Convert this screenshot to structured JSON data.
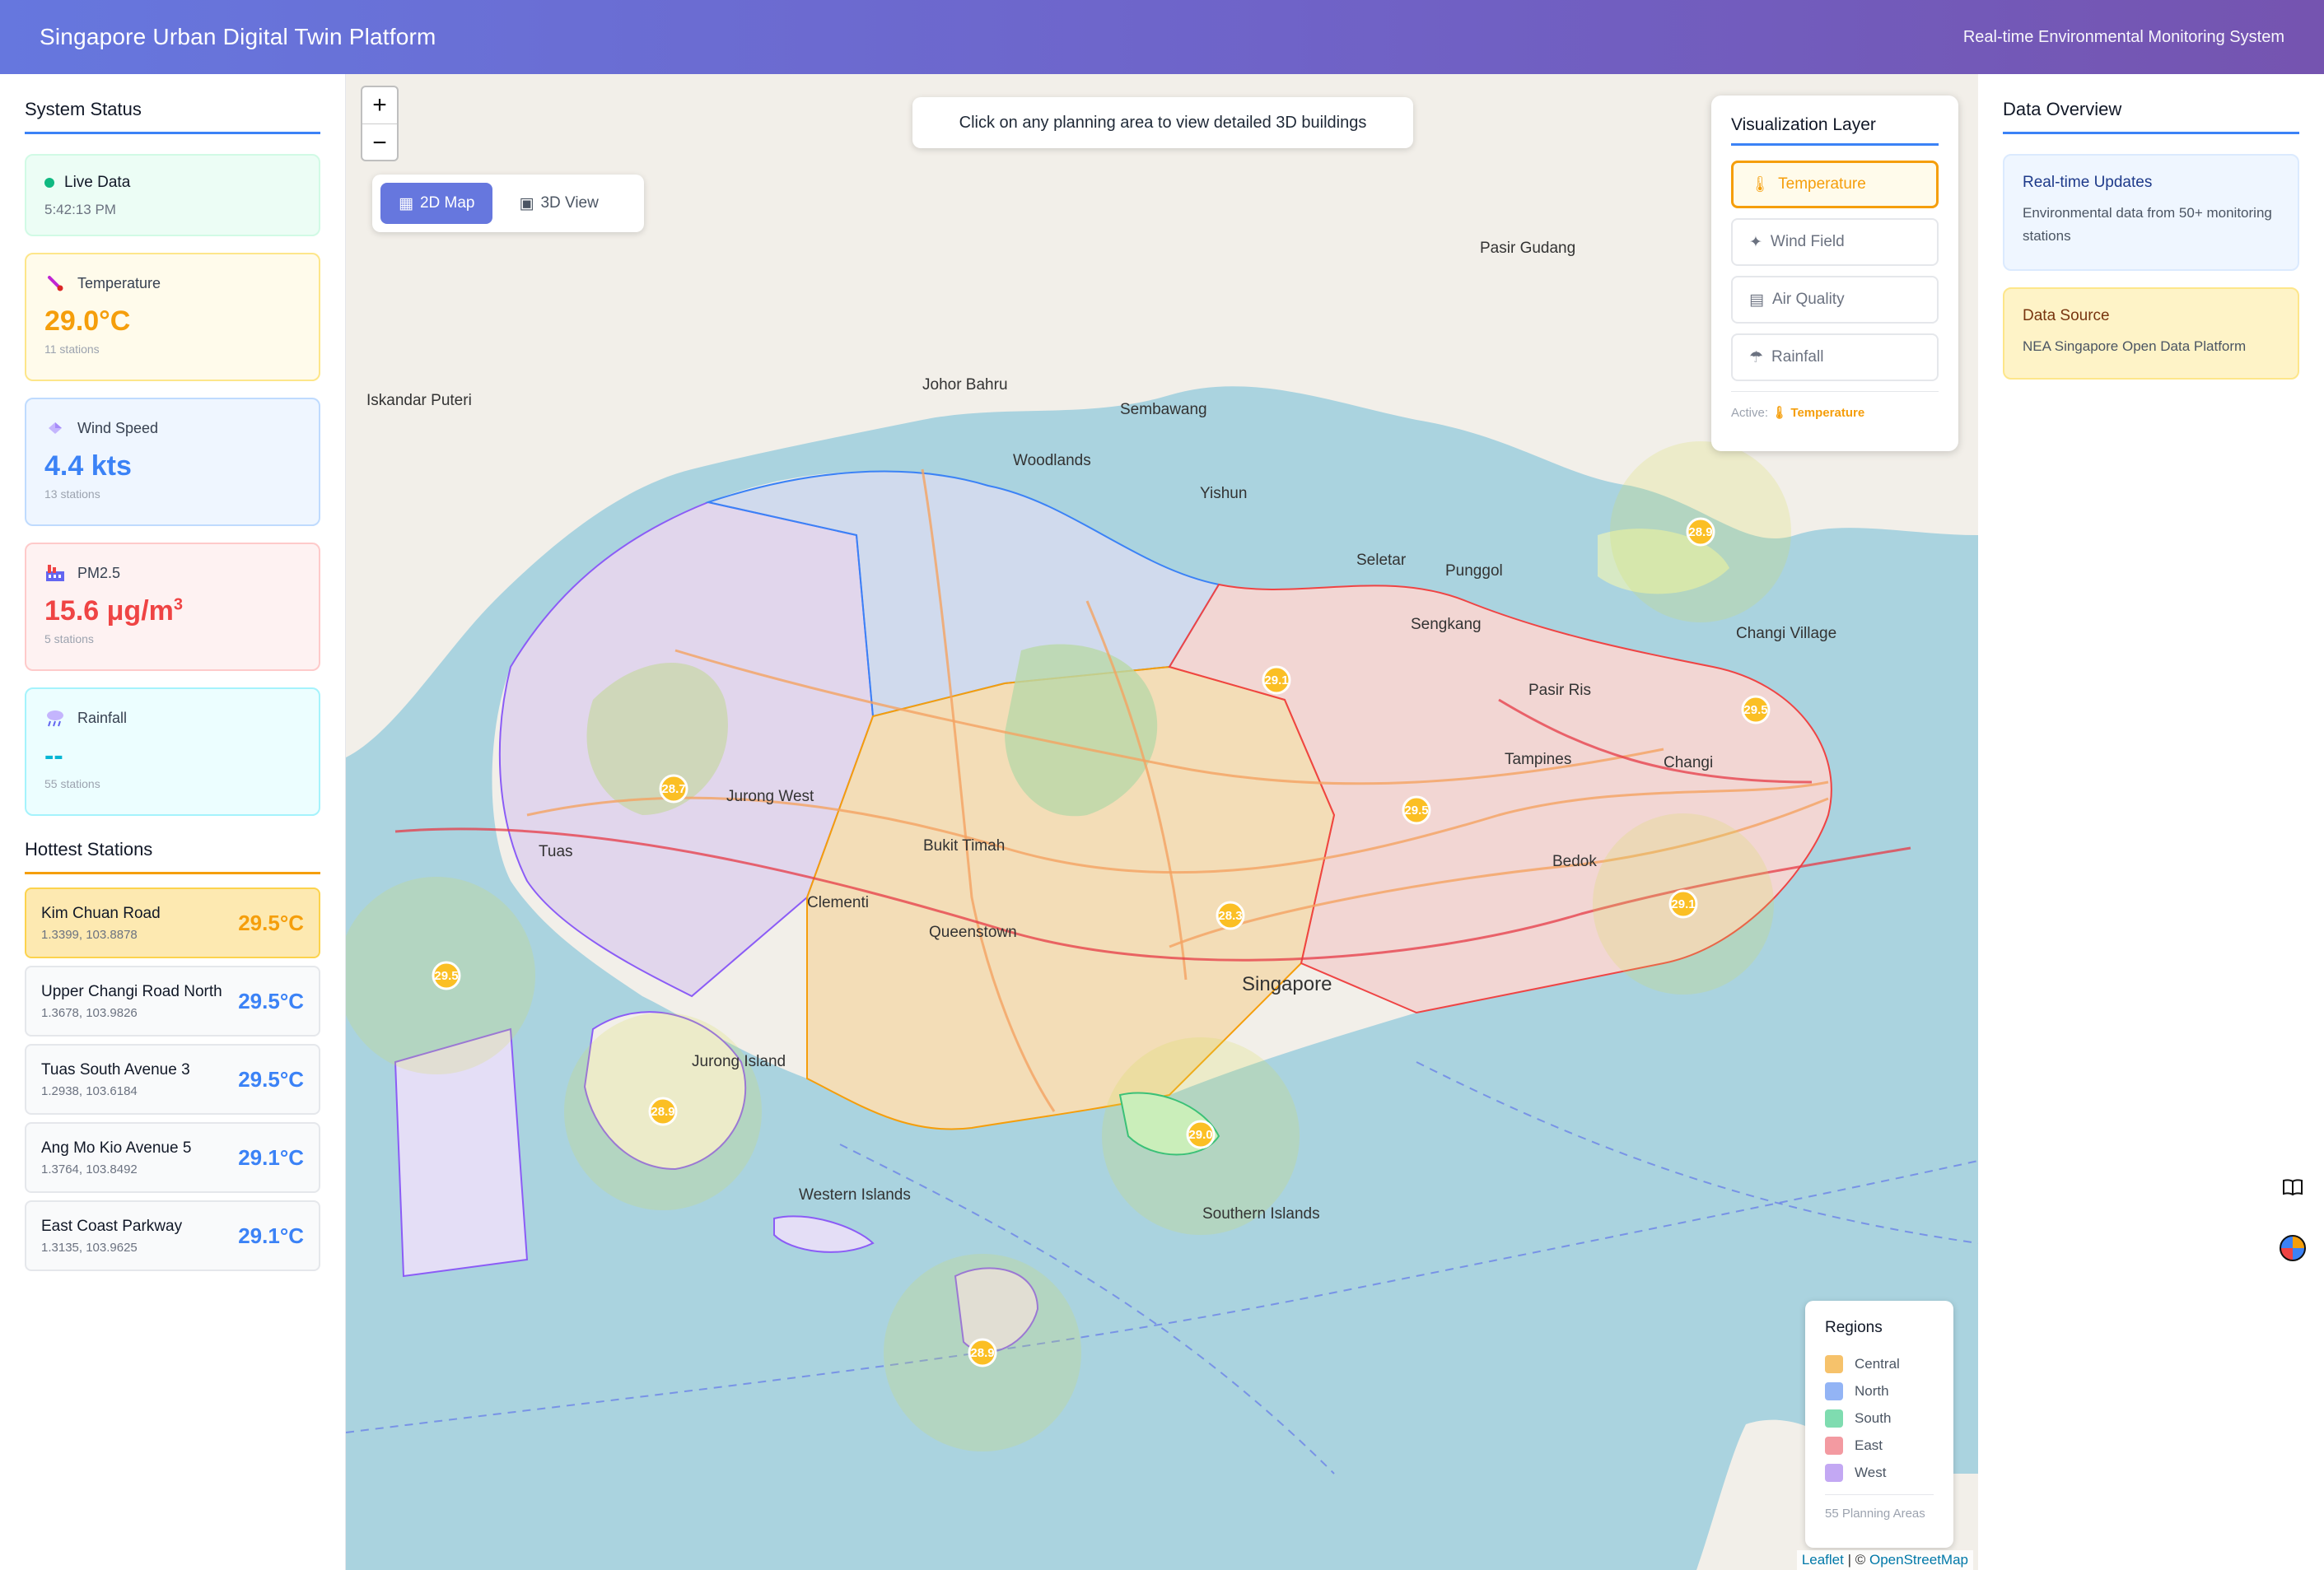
{
  "header": {
    "title": "Singapore Urban Digital Twin Platform",
    "subtitle": "Real-time Environmental Monitoring System"
  },
  "left": {
    "system_status_title": "System Status",
    "live": {
      "label": "Live Data",
      "time": "5:42:13 PM"
    },
    "metrics": [
      {
        "label": "Temperature",
        "value": "29.0°C",
        "stations": "11 stations",
        "icon": "thermometer-icon"
      },
      {
        "label": "Wind Speed",
        "value": "4.4 kts",
        "stations": "13 stations",
        "icon": "wind-icon"
      },
      {
        "label": "PM2.5",
        "value": "15.6 μg/m",
        "value_sup": "3",
        "stations": "5 stations",
        "icon": "factory-icon"
      },
      {
        "label": "Rainfall",
        "value": "--",
        "stations": "55 stations",
        "icon": "rain-cloud-icon"
      }
    ],
    "hottest_title": "Hottest Stations",
    "stations": [
      {
        "name": "Kim Chuan Road",
        "coord": "1.3399, 103.8878",
        "temp": "29.5°C"
      },
      {
        "name": "Upper Changi Road North",
        "coord": "1.3678, 103.9826",
        "temp": "29.5°C"
      },
      {
        "name": "Tuas South Avenue 3",
        "coord": "1.2938, 103.6184",
        "temp": "29.5°C"
      },
      {
        "name": "Ang Mo Kio Avenue 5",
        "coord": "1.3764, 103.8492",
        "temp": "29.1°C"
      },
      {
        "name": "East Coast Parkway",
        "coord": "1.3135, 103.9625",
        "temp": "29.1°C"
      }
    ]
  },
  "map": {
    "zoom_in": "+",
    "zoom_out": "−",
    "view_2d": "2D Map",
    "view_3d": "3D View",
    "hint": "Click on any planning area to view detailed 3D buildings",
    "layer_panel": {
      "title": "Visualization Layer",
      "options": [
        "Temperature",
        "Wind Field",
        "Air Quality",
        "Rainfall"
      ],
      "active_label": "Active:",
      "active_value": "Temperature"
    },
    "legend": {
      "title": "Regions",
      "items": [
        {
          "name": "Central",
          "color": "#f6c26b"
        },
        {
          "name": "North",
          "color": "#93b4f5"
        },
        {
          "name": "South",
          "color": "#7fdcb0"
        },
        {
          "name": "East",
          "color": "#f39aa1"
        },
        {
          "name": "West",
          "color": "#c3a8f3"
        }
      ],
      "footer": "55 Planning Areas"
    },
    "attribution": {
      "leaflet": "Leaflet",
      "sep": " | © ",
      "osm": "OpenStreetMap"
    },
    "place_labels": [
      "Johor Bahru",
      "Woodlands",
      "Yishun",
      "Sembawang",
      "Seletar",
      "Punggol",
      "Sengkang",
      "Tampines",
      "Pasir Ris",
      "Changi",
      "Bedok",
      "Singapore",
      "Jurong West",
      "Tuas",
      "Clementi",
      "Queenstown",
      "Bukit Timah",
      "Pasir Gudang",
      "Iskandar Puteri",
      "Western Islands",
      "Southern Islands",
      "Jurong Island",
      "Changi Village"
    ],
    "temp_markers": [
      "28.9",
      "29.1",
      "29.5",
      "28.7",
      "29.5",
      "28.3",
      "29.1",
      "29.5",
      "28.9",
      "29.0",
      "28.9",
      "29.5"
    ]
  },
  "right": {
    "title": "Data Overview",
    "cards": [
      {
        "title": "Real-time Updates",
        "body": "Environmental data from 50+ monitoring stations"
      },
      {
        "title": "Data Source",
        "body": "NEA Singapore Open Data Platform"
      }
    ]
  }
}
